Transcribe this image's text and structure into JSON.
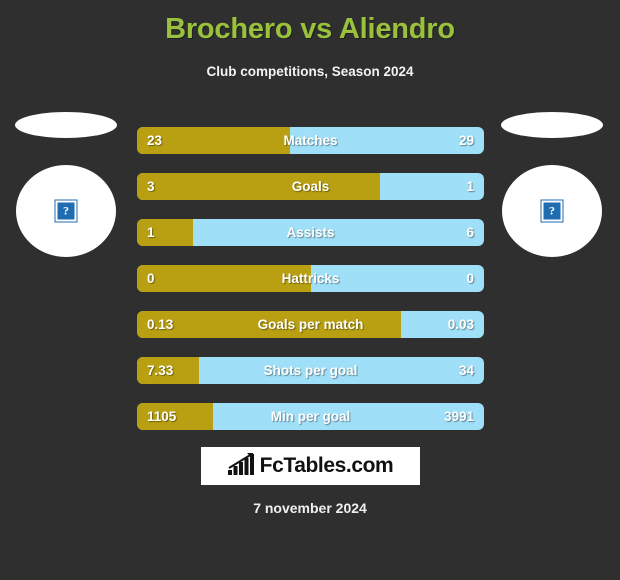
{
  "header": {
    "title": "Brochero vs Aliendro",
    "subtitle": "Club competitions, Season 2024"
  },
  "players": {
    "home": {
      "image_alt": "broken-image",
      "broken_glyph": "?"
    },
    "away": {
      "image_alt": "broken-image",
      "broken_glyph": "?"
    }
  },
  "colors": {
    "background": "#2f2f2f",
    "title": "#9ac13c",
    "home_bar": "#b8a012",
    "away_bar": "#9fdff7",
    "text": "#ffffff",
    "logo_background": "#ffffff"
  },
  "chart_data": {
    "type": "bar",
    "title": "Brochero vs Aliendro",
    "subtitle": "Club competitions, Season 2024",
    "series": [
      {
        "name": "Brochero",
        "color": "#b8a012"
      },
      {
        "name": "Aliendro",
        "color": "#9fdff7"
      }
    ],
    "categories": [
      "Matches",
      "Goals",
      "Assists",
      "Hattricks",
      "Goals per match",
      "Shots per goal",
      "Min per goal"
    ],
    "rows": [
      {
        "label": "Matches",
        "home": "23",
        "away": "29",
        "home_pct": 44
      },
      {
        "label": "Goals",
        "home": "3",
        "away": "1",
        "home_pct": 70
      },
      {
        "label": "Assists",
        "home": "1",
        "away": "6",
        "home_pct": 16
      },
      {
        "label": "Hattricks",
        "home": "0",
        "away": "0",
        "home_pct": 50
      },
      {
        "label": "Goals per match",
        "home": "0.13",
        "away": "0.03",
        "home_pct": 76
      },
      {
        "label": "Shots per goal",
        "home": "7.33",
        "away": "34",
        "home_pct": 18
      },
      {
        "label": "Min per goal",
        "home": "1105",
        "away": "3991",
        "home_pct": 22
      }
    ],
    "xlabel": "",
    "ylabel": "",
    "grid": false,
    "legend": "none"
  },
  "footer": {
    "logo_text": "FcTables.com",
    "logo_icon": "bar-chart-icon",
    "date": "7 november 2024"
  }
}
